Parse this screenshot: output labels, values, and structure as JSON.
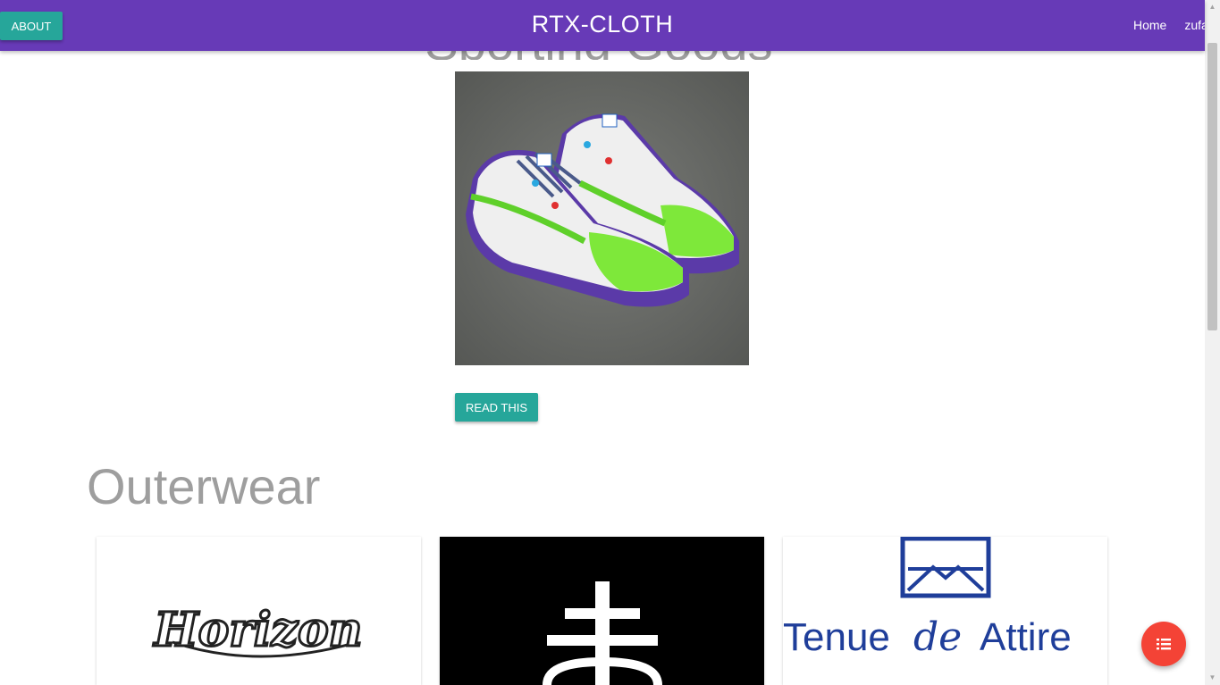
{
  "header": {
    "about_label": "ABOUT",
    "brand": "RTX-CLOTH",
    "nav": [
      "Home",
      "zufar"
    ]
  },
  "hero": {
    "heading": "Sporting Goods",
    "button_label": "READ THIS"
  },
  "sections": {
    "outerwear": {
      "title": "Outerwear",
      "cards": [
        {
          "logo_text": "Horizon"
        },
        {
          "logo_text": ""
        },
        {
          "logo_text": "Tenue de Attire",
          "logo_parts": [
            "Tenue",
            "de",
            "Attire"
          ]
        }
      ]
    }
  },
  "colors": {
    "navbar": "#673ab7",
    "teal_button": "#26a69a",
    "fab": "#f44336",
    "heading_gray": "#9e9e9e"
  },
  "icons": {
    "fab": "list-icon"
  }
}
